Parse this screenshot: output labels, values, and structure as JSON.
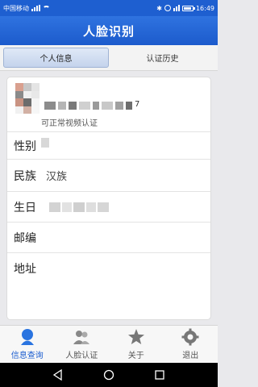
{
  "status_bar": {
    "carrier": "中国移动",
    "time": "16:49"
  },
  "header": {
    "title": "人脸识别"
  },
  "tabs": [
    {
      "label": "个人信息",
      "active": true
    },
    {
      "label": "认证历史",
      "active": false
    }
  ],
  "profile": {
    "name_tail": "7",
    "verify_status": "可正常视频认证"
  },
  "fields": [
    {
      "label": "性别",
      "value": ""
    },
    {
      "label": "民族",
      "value": "汉族"
    },
    {
      "label": "生日",
      "value": ""
    },
    {
      "label": "邮编",
      "value": ""
    },
    {
      "label": "地址",
      "value": ""
    }
  ],
  "nav": [
    {
      "label": "信息查询",
      "icon": "person-icon",
      "active": true
    },
    {
      "label": "人脸认证",
      "icon": "users-icon",
      "active": false
    },
    {
      "label": "关于",
      "icon": "star-icon",
      "active": false
    },
    {
      "label": "退出",
      "icon": "gear-icon",
      "active": false
    }
  ],
  "colors": {
    "primary": "#1e5fd0",
    "nav_active": "#1e5fd0"
  }
}
